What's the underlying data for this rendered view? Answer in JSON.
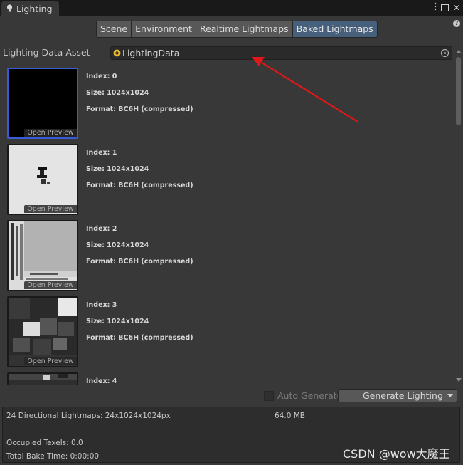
{
  "window": {
    "tab_title": "Lighting",
    "help_glyph": "?"
  },
  "modes": [
    {
      "label": "Scene",
      "active": false
    },
    {
      "label": "Environment",
      "active": false
    },
    {
      "label": "Realtime Lightmaps",
      "active": false
    },
    {
      "label": "Baked Lightmaps",
      "active": true
    }
  ],
  "asset": {
    "label": "Lighting Data Asset",
    "value": "LightingData"
  },
  "lightmaps": [
    {
      "index": "Index: 0",
      "size": "Size: 1024x1024",
      "format": "Format: BC6H (compressed)",
      "preview_label": "Open Preview",
      "selected": true
    },
    {
      "index": "Index: 1",
      "size": "Size: 1024x1024",
      "format": "Format: BC6H (compressed)",
      "preview_label": "Open Preview",
      "selected": false
    },
    {
      "index": "Index: 2",
      "size": "Size: 1024x1024",
      "format": "Format: BC6H (compressed)",
      "preview_label": "Open Preview",
      "selected": false
    },
    {
      "index": "Index: 3",
      "size": "Size: 1024x1024",
      "format": "Format: BC6H (compressed)",
      "preview_label": "Open Preview",
      "selected": false
    },
    {
      "index": "Index: 4",
      "size": "",
      "format": "",
      "preview_label": "",
      "selected": false
    }
  ],
  "controls": {
    "auto_generate_label": "Auto Generate",
    "auto_generate_checked": false,
    "generate_label": "Generate Lighting"
  },
  "stats": {
    "lightmaps": "24 Directional Lightmaps: 24x1024x1024px",
    "memory": "64.0 MB",
    "occupied": "Occupied Texels: 0.0",
    "bake_time": "Total Bake Time: 0:00:00"
  },
  "watermark": "CSDN @wow大魔王",
  "colors": {
    "background": "#383838",
    "active_tab": "#46607c",
    "annotation_arrow": "#e01818",
    "selection": "#3a5bd6"
  }
}
